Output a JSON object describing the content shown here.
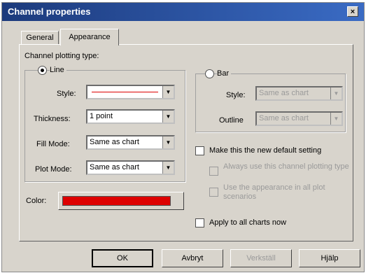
{
  "window": {
    "title": "Channel properties",
    "close_label": "×"
  },
  "tabs": [
    {
      "label": "General"
    },
    {
      "label": "Appearance"
    }
  ],
  "plotting": {
    "section_label": "Channel plotting type:",
    "line": {
      "label": "Line",
      "selected": true,
      "style_label": "Style:",
      "style_line_color": "#dd0000",
      "thickness_label": "Thickness:",
      "thickness_value": "1 point",
      "fill_mode_label": "Fill Mode:",
      "fill_mode_value": "Same as chart",
      "plot_mode_label": "Plot Mode:",
      "plot_mode_value": "Same as chart"
    },
    "bar": {
      "label": "Bar",
      "selected": false,
      "style_label": "Style:",
      "style_value": "Same as chart",
      "outline_label": "Outline",
      "outline_value": "Same as chart"
    }
  },
  "color": {
    "label": "Color:",
    "value": "#dd0000"
  },
  "options": {
    "default_setting": "Make this the new default setting",
    "always_use": "Always use this channel plotting type",
    "use_appearance": "Use the appearance in all plot scenarios",
    "apply_all": "Apply to all charts now"
  },
  "buttons": {
    "ok": "OK",
    "cancel": "Avbryt",
    "apply": "Verkställ",
    "help": "Hjälp"
  },
  "icons": {
    "dropdown": "▼"
  }
}
